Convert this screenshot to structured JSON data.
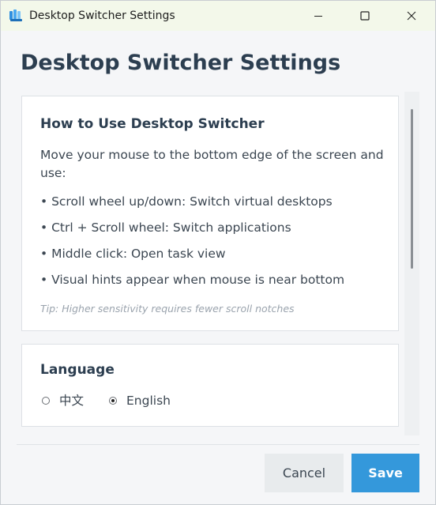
{
  "window": {
    "title": "Desktop Switcher Settings"
  },
  "page": {
    "title": "Desktop Switcher Settings"
  },
  "howto": {
    "heading": "How to Use Desktop Switcher",
    "intro_line1": "Move your mouse to the bottom edge of the screen and",
    "intro_line2": "use:",
    "bullets": [
      "• Scroll wheel up/down: Switch virtual desktops",
      "• Ctrl + Scroll wheel: Switch applications",
      "• Middle click: Open task view",
      "• Visual hints appear when mouse is near bottom"
    ],
    "tip": "Tip: Higher sensitivity requires fewer scroll notches"
  },
  "language": {
    "heading": "Language",
    "options": [
      {
        "label": "中文",
        "selected": false
      },
      {
        "label": "English",
        "selected": true
      }
    ]
  },
  "footer": {
    "cancel_label": "Cancel",
    "save_label": "Save"
  },
  "colors": {
    "accent": "#3498db",
    "heading": "#2c3e50",
    "titlebar": "#f3f8ea"
  }
}
